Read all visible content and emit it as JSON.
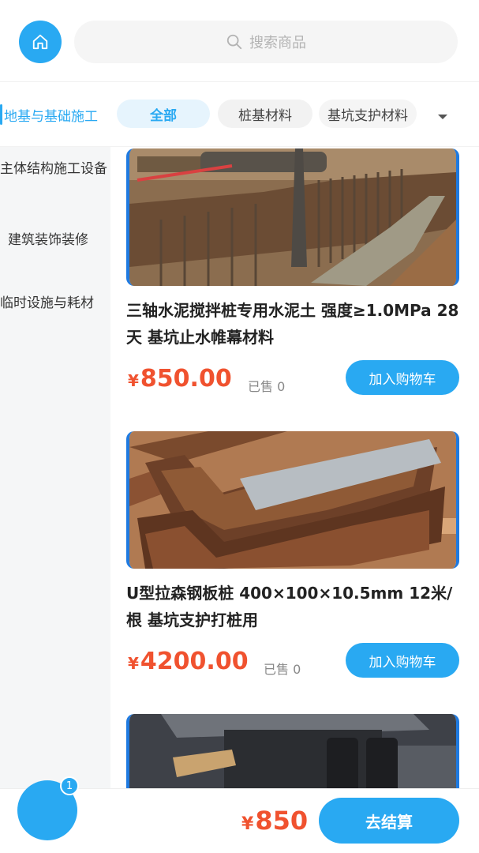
{
  "header": {
    "search_placeholder": "搜索商品",
    "home_icon": "home-icon",
    "search_icon": "search-icon"
  },
  "categories": {
    "sidebar_active": "地基与基础施工",
    "chips": [
      "全部",
      "桩基材料",
      "基坑支护材料"
    ],
    "active_chip": "全部",
    "dropdown_icon": "triangle-down-icon"
  },
  "sidebar": {
    "items": [
      "主体结构施工设备",
      "建筑装饰装修",
      "临时设施与耗材"
    ]
  },
  "products": [
    {
      "title": "三轴水泥搅拌桩专用水泥土 强度≥1.0MPa 28天 基坑止水帷幕材料",
      "price": "850.00",
      "currency": "¥",
      "sold": "已售 0",
      "button": "加入购物车"
    },
    {
      "title": "U型拉森钢板桩 400×100×10.5mm 12米/根 基坑支护打桩用",
      "price": "4200.00",
      "currency": "¥",
      "sold": "已售 0",
      "button": "加入购物车"
    }
  ],
  "footer": {
    "cart_count": "1",
    "total_currency": "¥",
    "total": "850",
    "checkout": "去结算"
  },
  "colors": {
    "accent": "#29a9f2",
    "price": "#f0522f",
    "sidebar_bg": "#f5f6f7"
  }
}
